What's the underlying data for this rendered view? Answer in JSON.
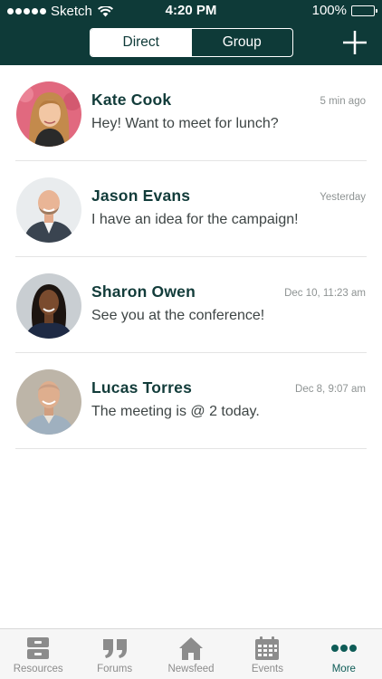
{
  "status_bar": {
    "carrier": "Sketch",
    "time": "4:20 PM",
    "battery": "100%"
  },
  "header": {
    "segments": [
      {
        "label": "Direct"
      },
      {
        "label": "Group"
      }
    ],
    "selected_segment": "Direct"
  },
  "messages": [
    {
      "name": "Kate Cook",
      "preview": "Hey! Want to meet for lunch?",
      "time": "5 min ago"
    },
    {
      "name": "Jason Evans",
      "preview": "I have an idea for the campaign!",
      "time": "Yesterday"
    },
    {
      "name": "Sharon Owen",
      "preview": "See you at the conference!",
      "time": "Dec 10, 11:23 am"
    },
    {
      "name": "Lucas Torres",
      "preview": "The meeting is @ 2 today.",
      "time": "Dec 8, 9:07 am"
    }
  ],
  "tabbar": {
    "tabs": [
      {
        "label": "Resources",
        "icon": "archive-box-icon"
      },
      {
        "label": "Forums",
        "icon": "quote-icon"
      },
      {
        "label": "Newsfeed",
        "icon": "home-icon"
      },
      {
        "label": "Events",
        "icon": "calendar-icon"
      },
      {
        "label": "More",
        "icon": "more-dots-icon"
      }
    ],
    "active_tab": "More"
  },
  "colors": {
    "header_bg": "#0e3a38",
    "accent": "#0e5c57",
    "name_text": "#123c3a",
    "inactive_tab": "#8c8c8c"
  }
}
